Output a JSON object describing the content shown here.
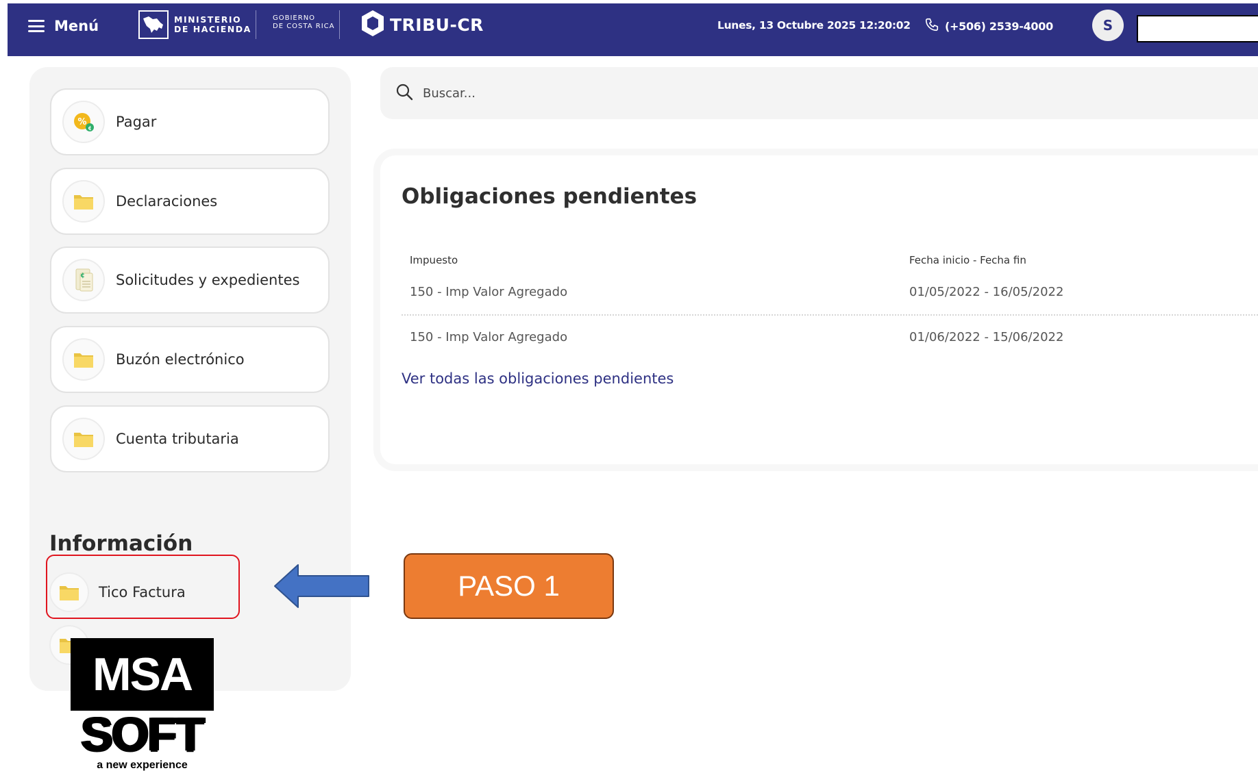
{
  "header": {
    "menu_label": "Menú",
    "ministry_text": "MINISTERIO\nDE HACIENDA",
    "gov_text": "GOBIERNO\nDE COSTA RICA",
    "app_name": "TRIBU-CR",
    "datetime": "Lunes, 13 Octubre 2025 12:20:02",
    "phone": "(+506) 2539-4000",
    "avatar_initial": "S",
    "brand_color": "#2e3183"
  },
  "sidebar": {
    "actions": [
      {
        "label": "Pagar",
        "icon": "pay-percent-icon"
      },
      {
        "label": "Declaraciones",
        "icon": "folder-icon"
      },
      {
        "label": "Solicitudes y expedientes",
        "icon": "document-dollar-icon"
      },
      {
        "label": "Buzón electrónico",
        "icon": "folder-icon"
      },
      {
        "label": "Cuenta tributaria",
        "icon": "folder-icon"
      }
    ],
    "info_heading": "Información",
    "info_items": [
      {
        "label": "Tico Factura",
        "icon": "folder-icon"
      }
    ]
  },
  "search": {
    "placeholder": "Buscar..."
  },
  "obligations": {
    "title": "Obligaciones pendientes",
    "columns": [
      "Impuesto",
      "Fecha inicio - Fecha fin"
    ],
    "rows": [
      {
        "tax": "150 - Imp Valor Agregado",
        "period": "01/05/2022 - 16/05/2022"
      },
      {
        "tax": "150 - Imp Valor Agregado",
        "period": "01/06/2022 - 15/06/2022"
      }
    ],
    "view_all_link": "Ver todas las obligaciones pendientes"
  },
  "annotation": {
    "step_label": "PASO 1",
    "step_color": "#ed7d31",
    "highlight_color": "#e0141e",
    "arrow_color": "#4472c4"
  },
  "watermark": {
    "line1": "MSA",
    "line2": "SOFT",
    "tagline": "a new experience"
  }
}
